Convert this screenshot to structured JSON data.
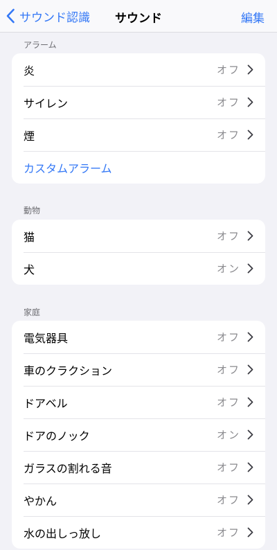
{
  "nav": {
    "back_label": "サウンド認識",
    "title": "サウンド",
    "edit_label": "編集"
  },
  "sections": {
    "alarms": {
      "header": "アラーム",
      "items": [
        {
          "label": "炎",
          "value": "オフ"
        },
        {
          "label": "サイレン",
          "value": "オフ"
        },
        {
          "label": "煙",
          "value": "オフ"
        }
      ],
      "custom_label": "カスタムアラーム"
    },
    "animals": {
      "header": "動物",
      "items": [
        {
          "label": "猫",
          "value": "オフ"
        },
        {
          "label": "犬",
          "value": "オン"
        }
      ]
    },
    "household": {
      "header": "家庭",
      "items": [
        {
          "label": "電気器具",
          "value": "オフ"
        },
        {
          "label": "車のクラクション",
          "value": "オフ"
        },
        {
          "label": "ドアベル",
          "value": "オフ"
        },
        {
          "label": "ドアのノック",
          "value": "オン"
        },
        {
          "label": "ガラスの割れる音",
          "value": "オフ"
        },
        {
          "label": "やかん",
          "value": "オフ"
        },
        {
          "label": "水の出しっ放し",
          "value": "オフ"
        }
      ]
    }
  },
  "colors": {
    "accent": "#3478f6",
    "background": "#f2f2f7",
    "secondary_text": "#8a8a8e"
  }
}
